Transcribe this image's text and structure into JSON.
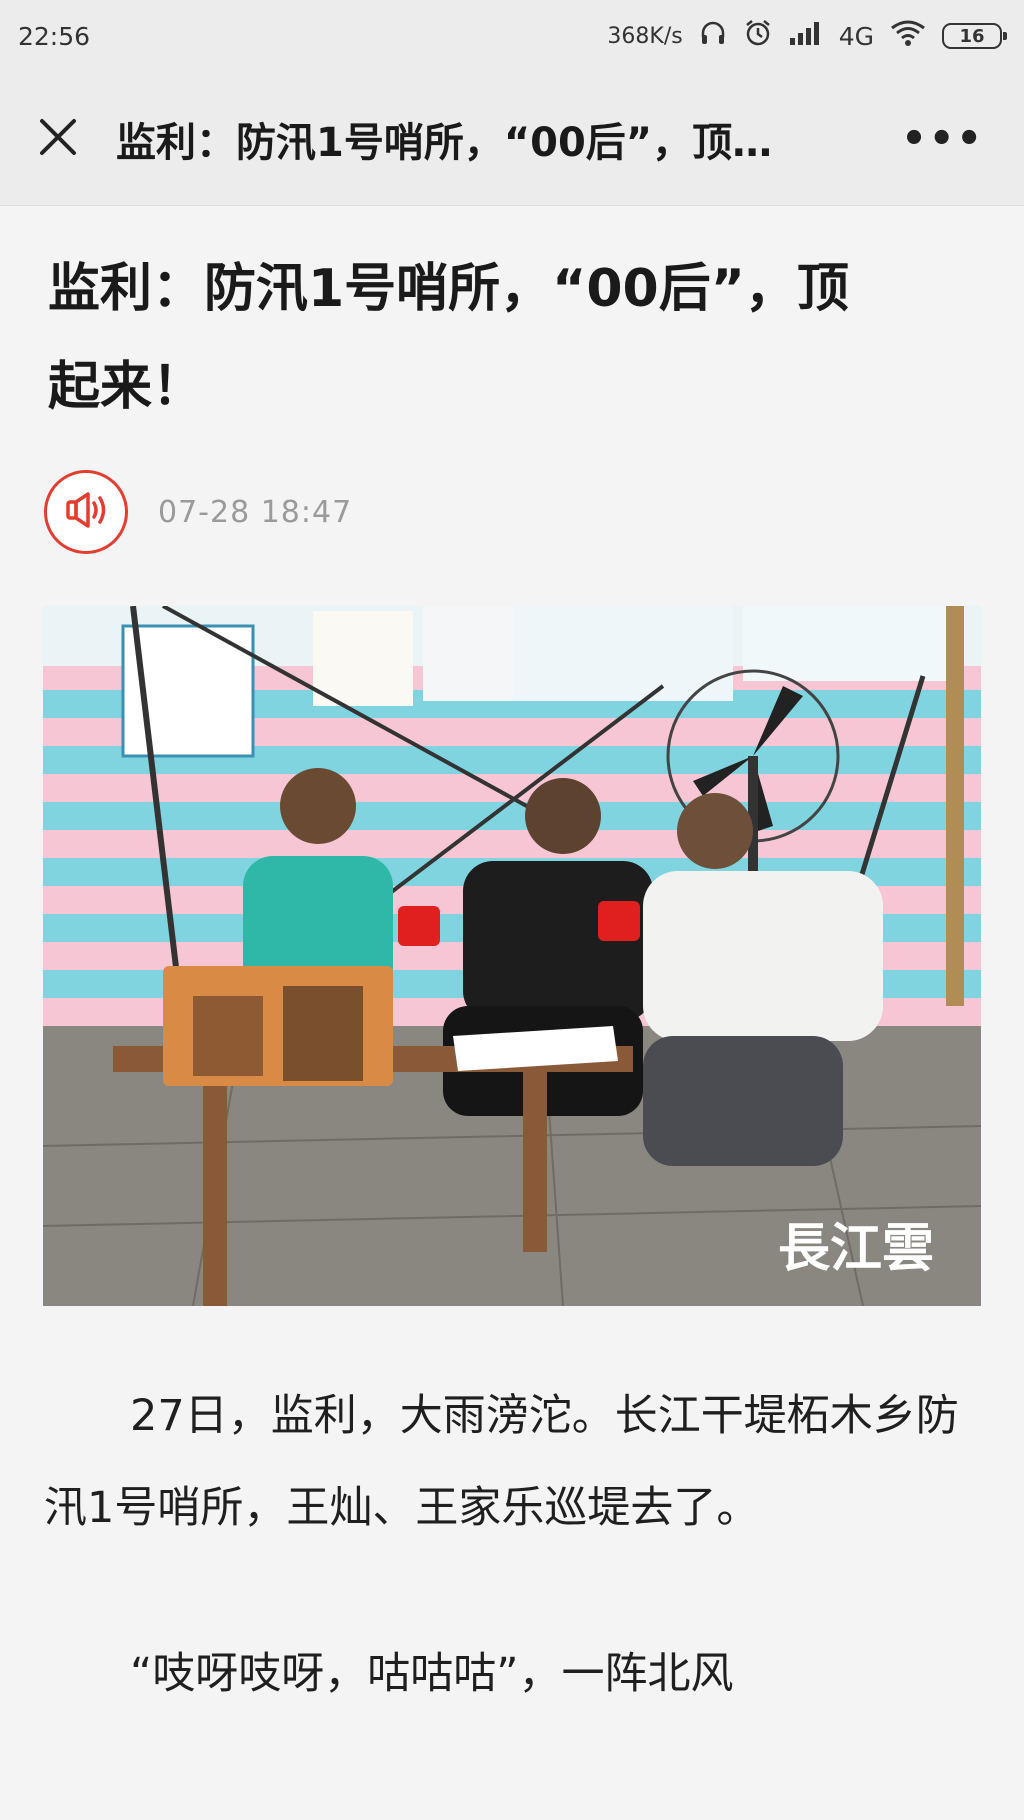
{
  "status_bar": {
    "time": "22:56",
    "net_speed": "368K/s",
    "network": "4G",
    "battery": "16",
    "icons": [
      "headphones-icon",
      "alarm-icon",
      "signal-icon",
      "wifi-icon",
      "battery-icon"
    ]
  },
  "header": {
    "title": "监利：防汛1号哨所，“00后”，顶…",
    "close_icon": "close-icon",
    "more_label": "•••"
  },
  "article": {
    "title": "监利：防汛1号哨所，“00后”，顶起来！",
    "date": "07-28 18:47",
    "audio_icon": "speaker-icon",
    "watermark": "長江雲",
    "paragraphs": [
      "27日，监利，大雨滂沱。长江干堤柘木乡防汛1号哨所，王灿、王家乐巡堤去了。",
      "“吱呀吱呀，咕咕咕”，一阵北风"
    ]
  },
  "colors": {
    "accent_red": "#e43d30",
    "header_bg": "#ececec",
    "page_bg": "#f4f4f4"
  }
}
